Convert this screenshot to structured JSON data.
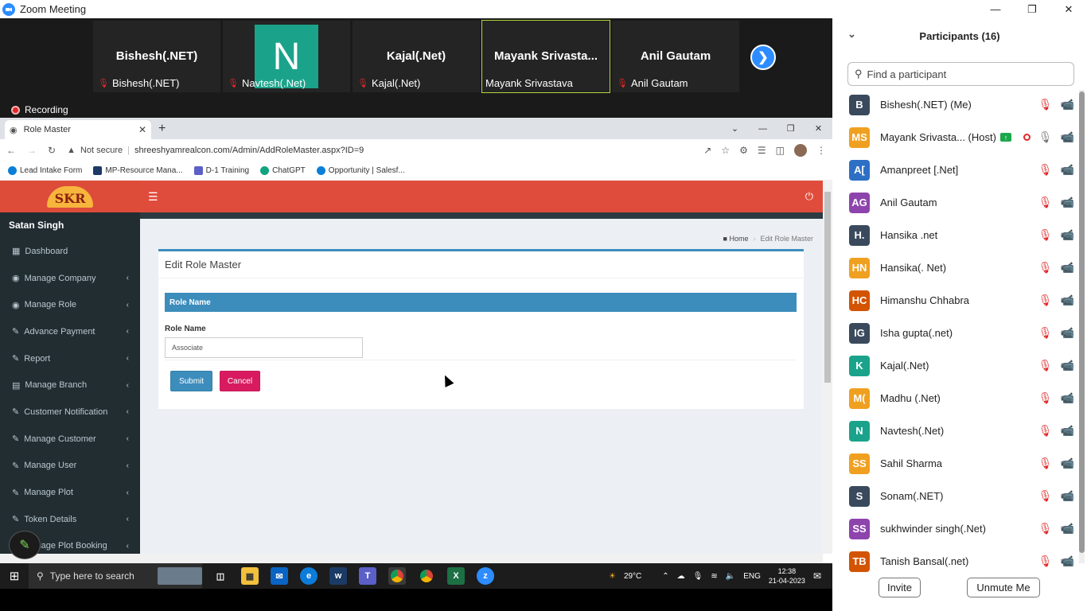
{
  "zoom": {
    "window_title": "Zoom Meeting",
    "recording_label": "Recording",
    "video_tiles": [
      {
        "display_name": "Bishesh(.NET)",
        "label": "Bishesh(.NET)"
      },
      {
        "display_name": "N",
        "label": "Navtesh(.Net)"
      },
      {
        "display_name": "Kajal(.Net)",
        "label": "Kajal(.Net)"
      },
      {
        "display_name": "Mayank  Srivasta...",
        "label": "Mayank Srivastava"
      },
      {
        "display_name": "Anil Gautam",
        "label": "Anil Gautam"
      }
    ]
  },
  "browser": {
    "tab_title": "Role Master",
    "security_label": "Not secure",
    "url": "shreeshyamrealcon.com/Admin/AddRoleMaster.aspx?ID=9",
    "bookmarks": [
      "Lead Intake Form",
      "MP-Resource Mana...",
      "D-1 Training",
      "ChatGPT",
      "Opportunity | Salesf..."
    ]
  },
  "webpage": {
    "logo": "SKR",
    "user_name": "Satan Singh",
    "nav": [
      "Dashboard",
      "Manage Company",
      "Manage Role",
      "Advance Payment",
      "Report",
      "Manage Branch",
      "Customer Notification",
      "Manage Customer",
      "Manage User",
      "Manage Plot",
      "Token Details",
      "Manage Plot Booking"
    ],
    "breadcrumb": {
      "home": "Home",
      "current": "Edit Role Master"
    },
    "box_title": "Edit Role Master",
    "section_title": "Role Name",
    "field_label": "Role Name",
    "field_value": "Associate",
    "submit_label": "Submit",
    "cancel_label": "Cancel"
  },
  "participants": {
    "title": "Participants (16)",
    "search_placeholder": "Find a participant",
    "list": [
      {
        "initials": "B",
        "name": "Bishesh(.NET) (Me)",
        "color": "#3a4a5c"
      },
      {
        "initials": "MS",
        "name": "Mayank Srivasta... (Host)",
        "color": "#f0a020"
      },
      {
        "initials": "A[",
        "name": "Amanpreet [.Net]",
        "color": "#2d6fc4"
      },
      {
        "initials": "AG",
        "name": "Anil Gautam",
        "color": "#8e44ad"
      },
      {
        "initials": "H.",
        "name": "Hansika .net",
        "color": "#3a4a5c"
      },
      {
        "initials": "HN",
        "name": "Hansika(. Net)",
        "color": "#f0a020"
      },
      {
        "initials": "HC",
        "name": "Himanshu Chhabra",
        "color": "#d35400"
      },
      {
        "initials": "IG",
        "name": "Isha gupta(.net)",
        "color": "#3a4a5c"
      },
      {
        "initials": "K",
        "name": "Kajal(.Net)",
        "color": "#1aa38a"
      },
      {
        "initials": "M(",
        "name": "Madhu (.Net)",
        "color": "#f0a020"
      },
      {
        "initials": "N",
        "name": "Navtesh(.Net)",
        "color": "#1aa38a"
      },
      {
        "initials": "SS",
        "name": "Sahil Sharma",
        "color": "#f0a020"
      },
      {
        "initials": "S",
        "name": "Sonam(.NET)",
        "color": "#3a4a5c"
      },
      {
        "initials": "SS",
        "name": "sukhwinder singh(.Net)",
        "color": "#8e44ad"
      },
      {
        "initials": "TB",
        "name": "Tanish Bansal(.net)",
        "color": "#d35400"
      }
    ],
    "invite_label": "Invite",
    "unmute_label": "Unmute Me"
  },
  "taskbar": {
    "search_placeholder": "Type here to search",
    "weather": "29°C",
    "language": "ENG",
    "time": "12:38",
    "date": "21-04-2023"
  }
}
